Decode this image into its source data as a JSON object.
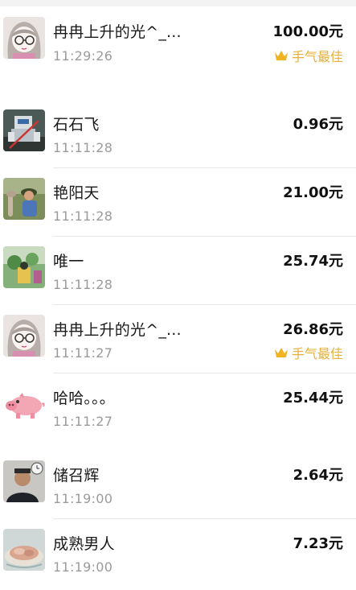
{
  "best_luck_label": "手气最佳",
  "entries": [
    {
      "name": "冉冉上升的光^_...",
      "time": "11:29:26",
      "amount": "100.00元",
      "best": true,
      "avatar": "anime-girl-avatar"
    },
    {
      "name": "石石飞",
      "time": "11:11:28",
      "amount": "0.96元",
      "best": false,
      "avatar": "robot-photo-avatar"
    },
    {
      "name": "艳阳天",
      "time": "11:11:28",
      "amount": "21.00元",
      "best": false,
      "avatar": "man-fishing-avatar"
    },
    {
      "name": "唯一",
      "time": "11:11:28",
      "amount": "25.74元",
      "best": false,
      "avatar": "plants-photo-avatar"
    },
    {
      "name": "冉冉上升的光^_...",
      "time": "11:11:27",
      "amount": "26.86元",
      "best": true,
      "avatar": "anime-girl-avatar"
    },
    {
      "name": "哈哈。。。",
      "time": "11:11:27",
      "amount": "25.44元",
      "best": false,
      "avatar": "pig-avatar"
    },
    {
      "name": "储召辉",
      "time": "11:19:00",
      "amount": "2.64元",
      "best": false,
      "avatar": "man-portrait-avatar"
    },
    {
      "name": "成熟男人",
      "time": "11:19:00",
      "amount": "7.23元",
      "best": false,
      "avatar": "food-bowl-avatar"
    }
  ]
}
